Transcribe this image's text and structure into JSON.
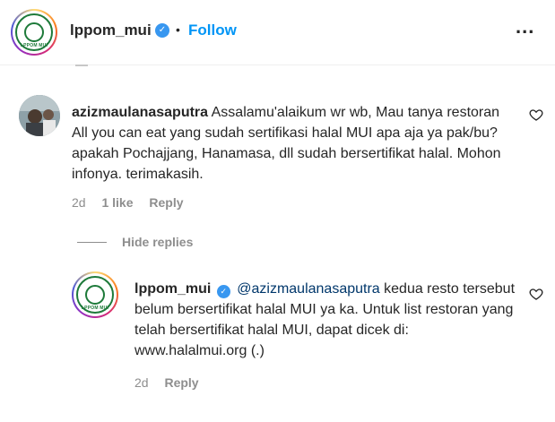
{
  "account": {
    "handle": "lppom_mui",
    "verified": true,
    "separator": "•",
    "follow_label": "Follow",
    "more_label": "...",
    "logo_text": "LPPOM MUI"
  },
  "comments": [
    {
      "username": "azizmaulanasaputra",
      "text": "Assalamu'alaikum wr wb, Mau tanya restoran All you can eat yang sudah sertifikasi halal MUI apa aja ya pak/bu? apakah Pochajjang, Hanamasa, dll sudah bersertifikat halal. Mohon infonya. terimakasih.",
      "time": "2d",
      "likes": "1 like",
      "reply_label": "Reply",
      "hide_replies_label": "Hide replies"
    }
  ],
  "reply": {
    "username": "lppom_mui",
    "verified": true,
    "mention": "@azizmaulanasaputra",
    "text": "kedua resto tersebut belum bersertifikat halal MUI ya ka. Untuk list restoran yang telah bersertifikat halal MUI, dapat dicek di: www.halalmui.org (.)",
    "time": "2d",
    "reply_label": "Reply"
  },
  "colors": {
    "accent": "#0095f6",
    "verified": "#3897f0",
    "muted": "#8e8e8e",
    "mention": "#00376b",
    "logo_green": "#1e7a3a"
  },
  "icons": [
    "verified-badge-icon",
    "more-options-icon",
    "heart-icon"
  ]
}
